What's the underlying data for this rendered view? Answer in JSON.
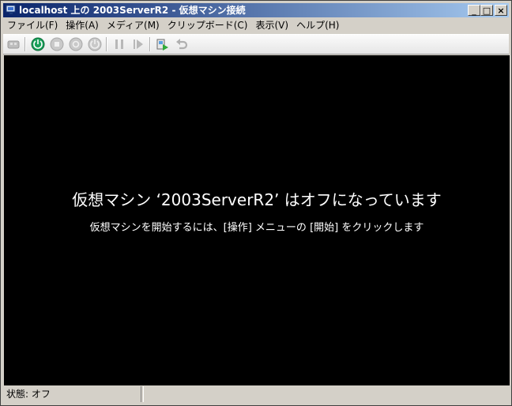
{
  "window": {
    "title": "localhost 上の 2003ServerR2 - 仮想マシン接続"
  },
  "title_buttons": {
    "minimize": "_",
    "maximize": "□",
    "close": "×"
  },
  "menu": [
    {
      "label": "ファイル(F)"
    },
    {
      "label": "操作(A)"
    },
    {
      "label": "メディア(M)"
    },
    {
      "label": "クリップボード(C)"
    },
    {
      "label": "表示(V)"
    },
    {
      "label": "ヘルプ(H)"
    }
  ],
  "toolbar": [
    {
      "icon": "ctrl-alt-del-icon",
      "enabled": false
    },
    {
      "icon": "start-icon",
      "enabled": true
    },
    {
      "icon": "turn-off-icon",
      "enabled": false
    },
    {
      "icon": "shutdown-icon",
      "enabled": false
    },
    {
      "icon": "save-state-icon",
      "enabled": false
    },
    {
      "icon": "pause-icon",
      "enabled": false
    },
    {
      "icon": "resume-icon",
      "enabled": false
    },
    {
      "icon": "snapshot-icon",
      "enabled": true
    },
    {
      "icon": "revert-icon",
      "enabled": false
    }
  ],
  "screen": {
    "heading": "仮想マシン ‘2003ServerR2’ はオフになっています",
    "subtext": "仮想マシンを開始するには、[操作] メニューの [開始] をクリックします"
  },
  "status": {
    "text": "状態: オフ"
  },
  "colors": {
    "title_start": "#0a246a",
    "title_end": "#a6caf0",
    "start_green": "#1aa05a",
    "disabled_gray": "#a8a8a8"
  }
}
